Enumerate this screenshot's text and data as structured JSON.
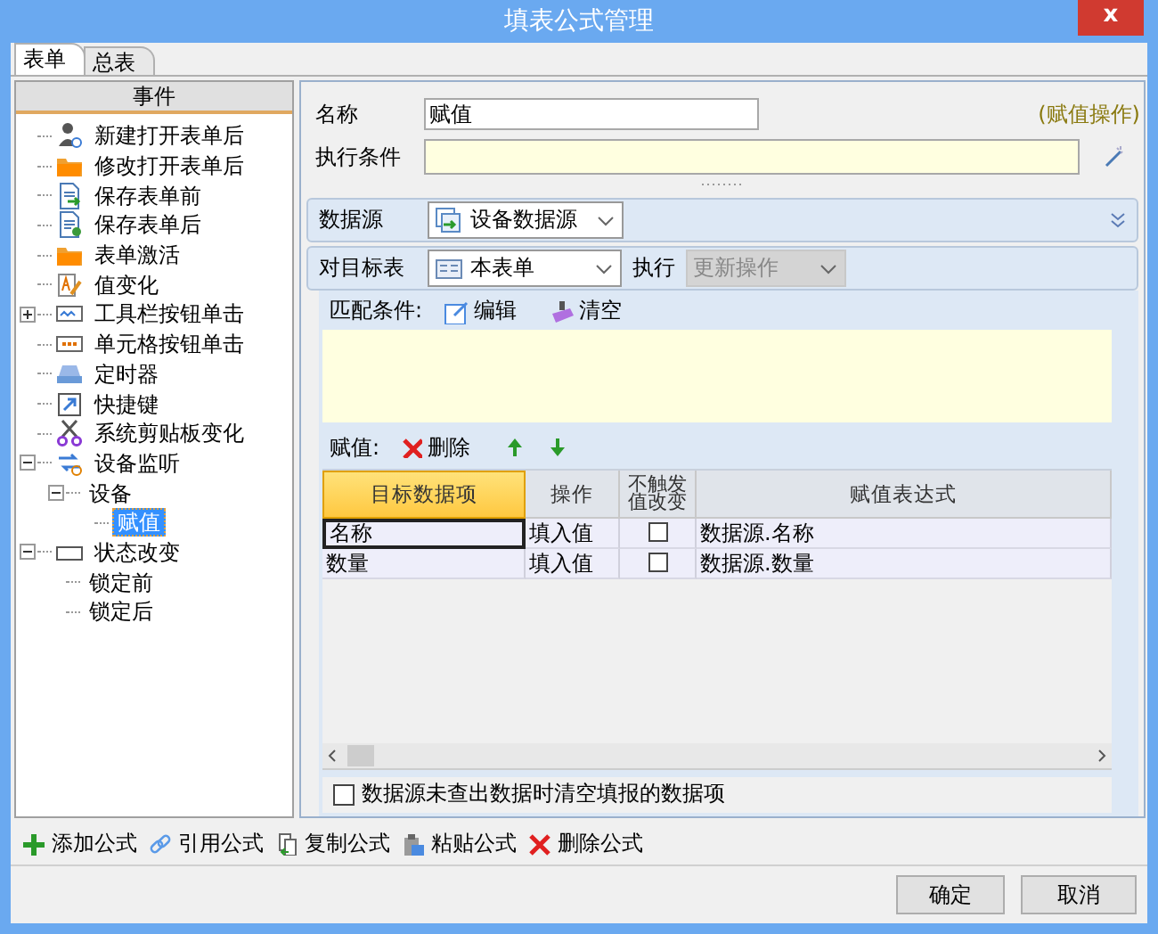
{
  "window": {
    "title": "填表公式管理",
    "close": "x"
  },
  "tabs": [
    {
      "label": "表单",
      "selected": true
    },
    {
      "label": "总表",
      "selected": false
    }
  ],
  "events": {
    "header": "事件",
    "items": [
      {
        "label": "新建打开表单后",
        "kind": "user",
        "selected": false
      },
      {
        "label": "修改打开表单后",
        "kind": "folder",
        "selected": false
      },
      {
        "label": "保存表单前",
        "kind": "save-before",
        "selected": false
      },
      {
        "label": "保存表单后",
        "kind": "save-after",
        "selected": false
      },
      {
        "label": "表单激活",
        "kind": "folder",
        "selected": false
      },
      {
        "label": "值变化",
        "kind": "value",
        "selected": false
      },
      {
        "label": "工具栏按钮单击",
        "kind": "toolbar",
        "selected": false,
        "expanded": false
      },
      {
        "label": "单元格按钮单击",
        "kind": "cell",
        "selected": false
      },
      {
        "label": "定时器",
        "kind": "timer",
        "selected": false
      },
      {
        "label": "快捷键",
        "kind": "shortcut",
        "selected": false
      },
      {
        "label": "系统剪贴板变化",
        "kind": "scissors",
        "selected": false
      },
      {
        "label": "设备监听",
        "kind": "device",
        "selected": false,
        "expanded": true,
        "children": [
          {
            "label": "设备",
            "selected": false,
            "expanded": true,
            "children": [
              {
                "label": "赋值",
                "selected": true
              }
            ]
          }
        ]
      },
      {
        "label": "状态改变",
        "kind": "state",
        "selected": false,
        "expanded": true,
        "children": [
          {
            "label": "锁定前",
            "selected": false
          },
          {
            "label": "锁定后",
            "selected": false
          }
        ]
      }
    ]
  },
  "formula": {
    "name_label": "名称",
    "name_value": "赋值",
    "type_hint": "(赋值操作)",
    "condition_label": "执行条件",
    "datasource_label": "数据源",
    "datasource_value": "设备数据源",
    "target_label": "对目标表",
    "target_value": "本表单",
    "exec_label": "执行",
    "exec_value": "更新操作",
    "exec_disabled": true,
    "match_label": "匹配条件:",
    "match_actions": [
      {
        "label": "编辑",
        "kind": "edit"
      },
      {
        "label": "清空",
        "kind": "clear"
      }
    ],
    "assign_label": "赋值:",
    "assign_actions": [
      {
        "label": "删除",
        "kind": "delete"
      }
    ],
    "columns": [
      {
        "label": "目标数据项",
        "selected": true
      },
      {
        "label": "操作",
        "selected": false
      },
      {
        "label": "不触发值改变",
        "selected": false
      },
      {
        "label": "赋值表达式",
        "selected": false
      }
    ],
    "rows": [
      {
        "target": "名称",
        "operation": "填入值",
        "no_trigger": false,
        "expression": "数据源.名称",
        "selected": true
      },
      {
        "target": "数量",
        "operation": "填入值",
        "no_trigger": false,
        "expression": "数据源.数量",
        "selected": false
      }
    ],
    "clear_option": {
      "label": "数据源未查出数据时清空填报的数据项",
      "checked": false
    }
  },
  "toolbar": [
    {
      "label": "添加公式",
      "kind": "add"
    },
    {
      "label": "引用公式",
      "kind": "link"
    },
    {
      "label": "复制公式",
      "kind": "copy"
    },
    {
      "label": "粘贴公式",
      "kind": "paste"
    },
    {
      "label": "删除公式",
      "kind": "delete"
    }
  ],
  "buttons": [
    "确定",
    "取消"
  ]
}
